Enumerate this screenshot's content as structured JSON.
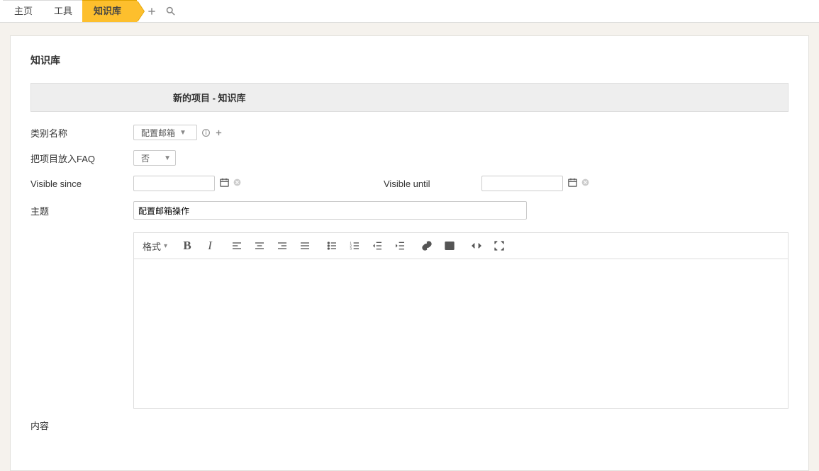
{
  "tabs": {
    "home": "主页",
    "tools": "工具",
    "kb": "知识库"
  },
  "icons": {
    "plus": "plus-icon",
    "search": "search-icon"
  },
  "page": {
    "title": "知识库",
    "formHeader": "新的项目 - 知识库"
  },
  "fields": {
    "categoryLabel": "类别名称",
    "categoryValue": "配置邮箱",
    "faqLabel": "把项目放入FAQ",
    "faqValue": "否",
    "visibleSince": "Visible since",
    "visibleUntil": "Visible until",
    "subjectLabel": "主题",
    "subjectValue": "配置邮箱操作",
    "contentLabel": "内容"
  },
  "editor": {
    "format": "格式"
  }
}
